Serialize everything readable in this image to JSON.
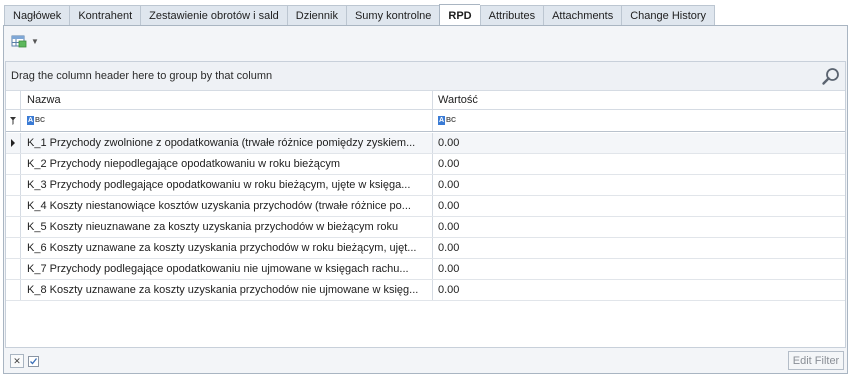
{
  "tabs": [
    {
      "label": "Nagłówek",
      "active": false
    },
    {
      "label": "Kontrahent",
      "active": false
    },
    {
      "label": "Zestawienie obrotów i sald",
      "active": false
    },
    {
      "label": "Dziennik",
      "active": false
    },
    {
      "label": "Sumy kontrolne",
      "active": false
    },
    {
      "label": "RPD",
      "active": true
    },
    {
      "label": "Attributes",
      "active": false
    },
    {
      "label": "Attachments",
      "active": false
    },
    {
      "label": "Change History",
      "active": false
    }
  ],
  "toolbar": {
    "icon": "grid-export-icon",
    "dropdown_icon": "chevron-down-icon"
  },
  "grid": {
    "group_hint": "Drag the column header here to group by that column",
    "columns": {
      "nazwa": "Nazwa",
      "wartosc": "Wartość"
    },
    "rows": [
      {
        "nazwa": "K_1 Przychody zwolnione z opodatkowania (trwałe różnice pomiędzy zyskiem...",
        "wartosc": "0.00"
      },
      {
        "nazwa": "K_2 Przychody niepodlegające opodatkowaniu w roku bieżącym",
        "wartosc": "0.00"
      },
      {
        "nazwa": "K_3 Przychody podlegające opodatkowaniu w roku bieżącym, ujęte w księga...",
        "wartosc": "0.00"
      },
      {
        "nazwa": "K_4 Koszty niestanowiące kosztów uzyskania przychodów (trwałe różnice po...",
        "wartosc": "0.00"
      },
      {
        "nazwa": "K_5 Koszty nieuznawane za koszty uzyskania przychodów w bieżącym roku",
        "wartosc": "0.00"
      },
      {
        "nazwa": "K_6 Koszty uznawane za koszty uzyskania przychodów w roku bieżącym, ujęt...",
        "wartosc": "0.00"
      },
      {
        "nazwa": "K_7 Przychody podlegające opodatkowaniu nie ujmowane w księgach rachu...",
        "wartosc": "0.00"
      },
      {
        "nazwa": "K_8 Koszty uznawane za koszty uzyskania przychodów nie ujmowane w księg...",
        "wartosc": "0.00"
      }
    ]
  },
  "bottom": {
    "edit_filter_label": "Edit Filter"
  },
  "colors": {
    "accent": "#3a7bd5",
    "tab_bg": "#dfe6ee",
    "border": "#a9b5c2"
  }
}
